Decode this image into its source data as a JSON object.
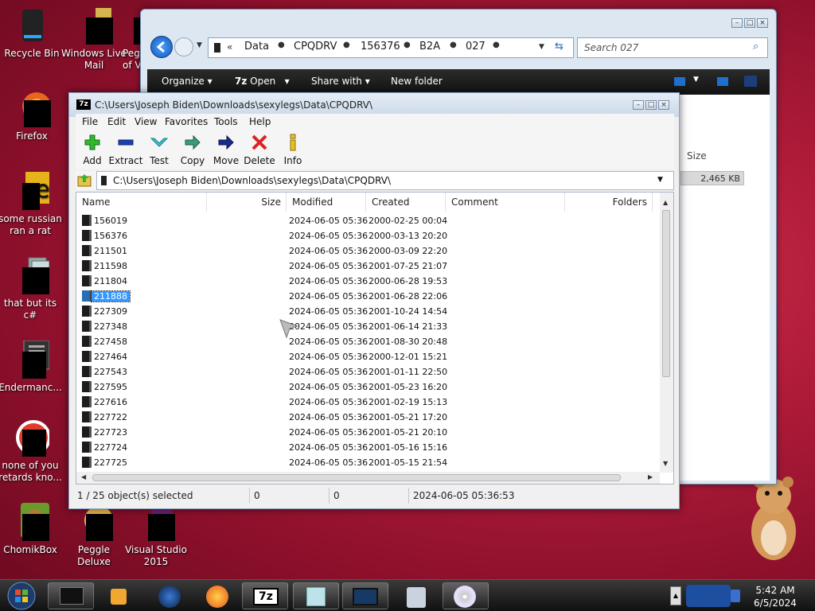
{
  "desktop": {
    "icons": [
      {
        "label": "Recycle Bin"
      },
      {
        "label": "Windows Live Mail"
      },
      {
        "label": "Peg of V"
      },
      {
        "label": "Firefox"
      },
      {
        "label": "some russian ran a rat"
      },
      {
        "label": "that but its c#"
      },
      {
        "label": "Endermanc..."
      },
      {
        "label": "none of you retards kno..."
      },
      {
        "label": "ChomikBox"
      },
      {
        "label": "Peggle Deluxe"
      },
      {
        "label": "Visual Studio 2015"
      }
    ]
  },
  "explorer": {
    "breadcrumb": [
      "Data",
      "CPQDRV",
      "156376",
      "B2A",
      "027"
    ],
    "search_placeholder": "Search 027",
    "toolbar": {
      "organize": "Organize",
      "open": "Open",
      "share_with": "Share with",
      "new_folder": "New folder"
    },
    "size_header": "Size",
    "size_value": "2,465 KB"
  },
  "zip": {
    "title": "C:\\Users\\Joseph Biden\\Downloads\\sexylegs\\Data\\CPQDRV\\",
    "app_icon_text": "7z",
    "menu": [
      "File",
      "Edit",
      "View",
      "Favorites",
      "Tools",
      "Help"
    ],
    "tools": [
      "Add",
      "Extract",
      "Test",
      "Copy",
      "Move",
      "Delete",
      "Info"
    ],
    "path": "C:\\Users\\Joseph Biden\\Downloads\\sexylegs\\Data\\CPQDRV\\",
    "columns": [
      "Name",
      "Size",
      "Modified",
      "Created",
      "Comment",
      "Folders"
    ],
    "rows": [
      {
        "name": "156019",
        "modified": "2024-06-05 05:36",
        "created": "2000-02-25 00:04"
      },
      {
        "name": "156376",
        "modified": "2024-06-05 05:36",
        "created": "2000-03-13 20:20"
      },
      {
        "name": "211501",
        "modified": "2024-06-05 05:36",
        "created": "2000-03-09 22:20"
      },
      {
        "name": "211598",
        "modified": "2024-06-05 05:36",
        "created": "2001-07-25 21:07"
      },
      {
        "name": "211804",
        "modified": "2024-06-05 05:36",
        "created": "2000-06-28 19:53"
      },
      {
        "name": "211888",
        "modified": "2024-06-05 05:36",
        "created": "2001-06-28 22:06",
        "selected": true
      },
      {
        "name": "227309",
        "modified": "2024-06-05 05:36",
        "created": "2001-10-24 14:54"
      },
      {
        "name": "227348",
        "modified": "2024-06-05 05:36",
        "created": "2001-06-14 21:33"
      },
      {
        "name": "227458",
        "modified": "2024-06-05 05:36",
        "created": "2001-08-30 20:48"
      },
      {
        "name": "227464",
        "modified": "2024-06-05 05:36",
        "created": "2000-12-01 15:21"
      },
      {
        "name": "227543",
        "modified": "2024-06-05 05:36",
        "created": "2001-01-11 22:50"
      },
      {
        "name": "227595",
        "modified": "2024-06-05 05:36",
        "created": "2001-05-23 16:20"
      },
      {
        "name": "227616",
        "modified": "2024-06-05 05:36",
        "created": "2001-02-19 15:13"
      },
      {
        "name": "227722",
        "modified": "2024-06-05 05:36",
        "created": "2001-05-21 17:20"
      },
      {
        "name": "227723",
        "modified": "2024-06-05 05:36",
        "created": "2001-05-21 20:10"
      },
      {
        "name": "227724",
        "modified": "2024-06-05 05:36",
        "created": "2001-05-16 15:16"
      },
      {
        "name": "227725",
        "modified": "2024-06-05 05:36",
        "created": "2001-05-15 21:54"
      }
    ],
    "status": {
      "selection": "1 / 25 object(s) selected",
      "size": "0",
      "packed": "0",
      "modified": "2024-06-05 05:36:53"
    }
  },
  "taskbar": {
    "time": "5:42 AM",
    "date": "6/5/2024",
    "zip_label": "7z"
  },
  "colors": {
    "desktop": "#b01c3a",
    "selection": "#3399ff",
    "taskbar": "#1a1a1a"
  }
}
